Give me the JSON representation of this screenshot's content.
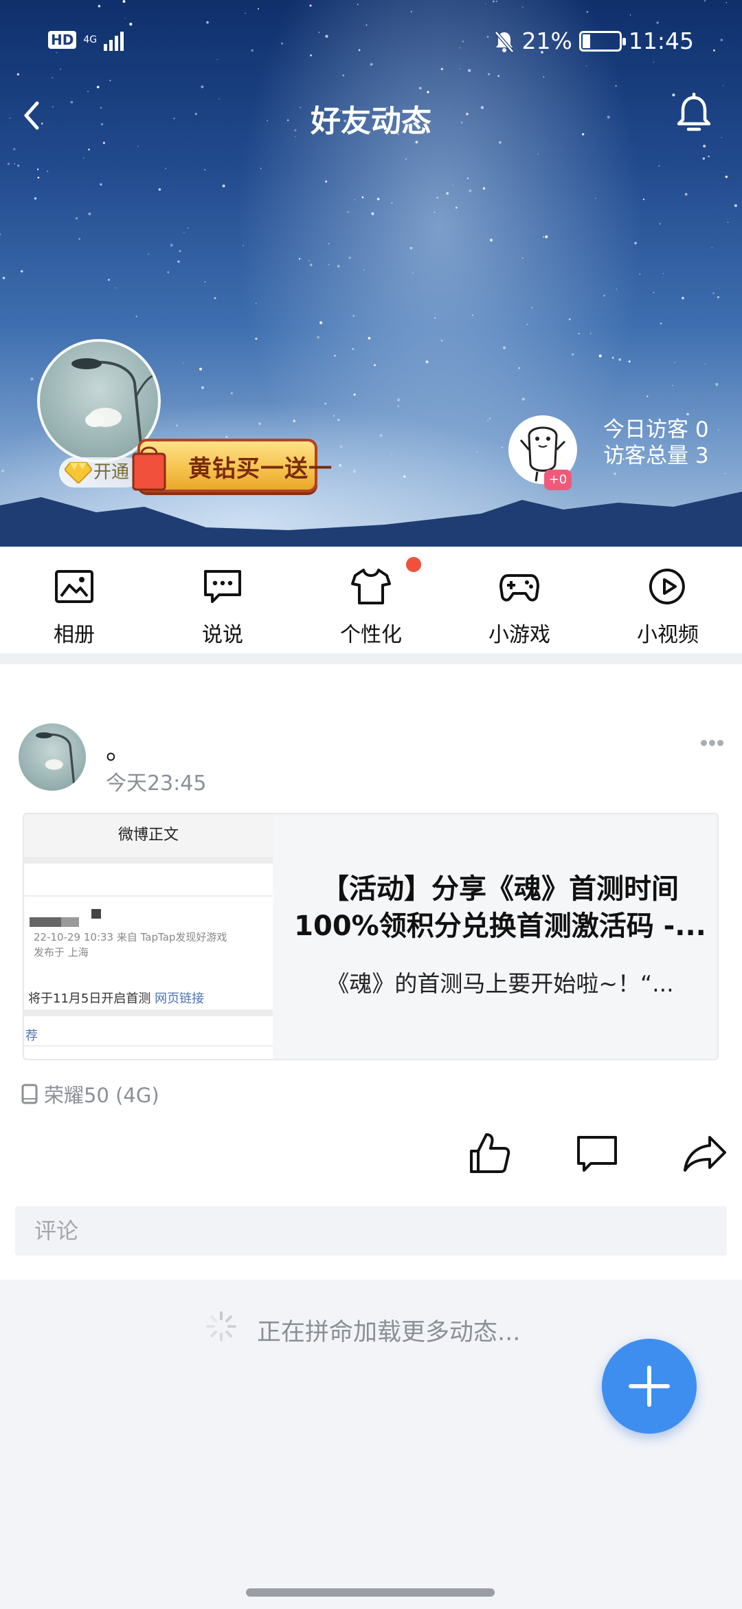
{
  "status_bar": {
    "hd": "HD",
    "network": "4G",
    "battery": "21%",
    "battery_level": 0.21,
    "time": "11:45"
  },
  "header": {
    "title": "好友动态",
    "vip_open_label": "开通",
    "promo_text": "黄钻买一送一",
    "visitor_badge": "+0",
    "today_visitors": "今日访客 0",
    "total_visitors": "访客总量 3"
  },
  "shortcuts": [
    {
      "label": "相册",
      "icon": "album-icon"
    },
    {
      "label": "说说",
      "icon": "chat-icon"
    },
    {
      "label": "个性化",
      "icon": "tshirt-icon"
    },
    {
      "label": "小游戏",
      "icon": "gamepad-icon"
    },
    {
      "label": "小视频",
      "icon": "play-icon"
    }
  ],
  "post": {
    "author": "。",
    "time": "今天23:45",
    "share": {
      "thumb_header": "微博正文",
      "thumb_meta_line1": "22-10-29 10:33   来自 TapTap发现好游戏",
      "thumb_meta_line2": "发布于 上海",
      "thumb_text": "将于11月5日开启首测 ",
      "thumb_link": "网页链接",
      "thumb_rec": "荐",
      "title": "【活动】分享《魂》首测时间100%领积分兑换首测激活码 -...",
      "description": "《魂》的首测马上要开始啦~！“..."
    },
    "device": "荣耀50 (4G)",
    "comment_placeholder": "评论"
  },
  "loading_text": "正在拼命加载更多动态...",
  "colors": {
    "accent": "#3e8ef0",
    "badge": "#f0503c"
  }
}
